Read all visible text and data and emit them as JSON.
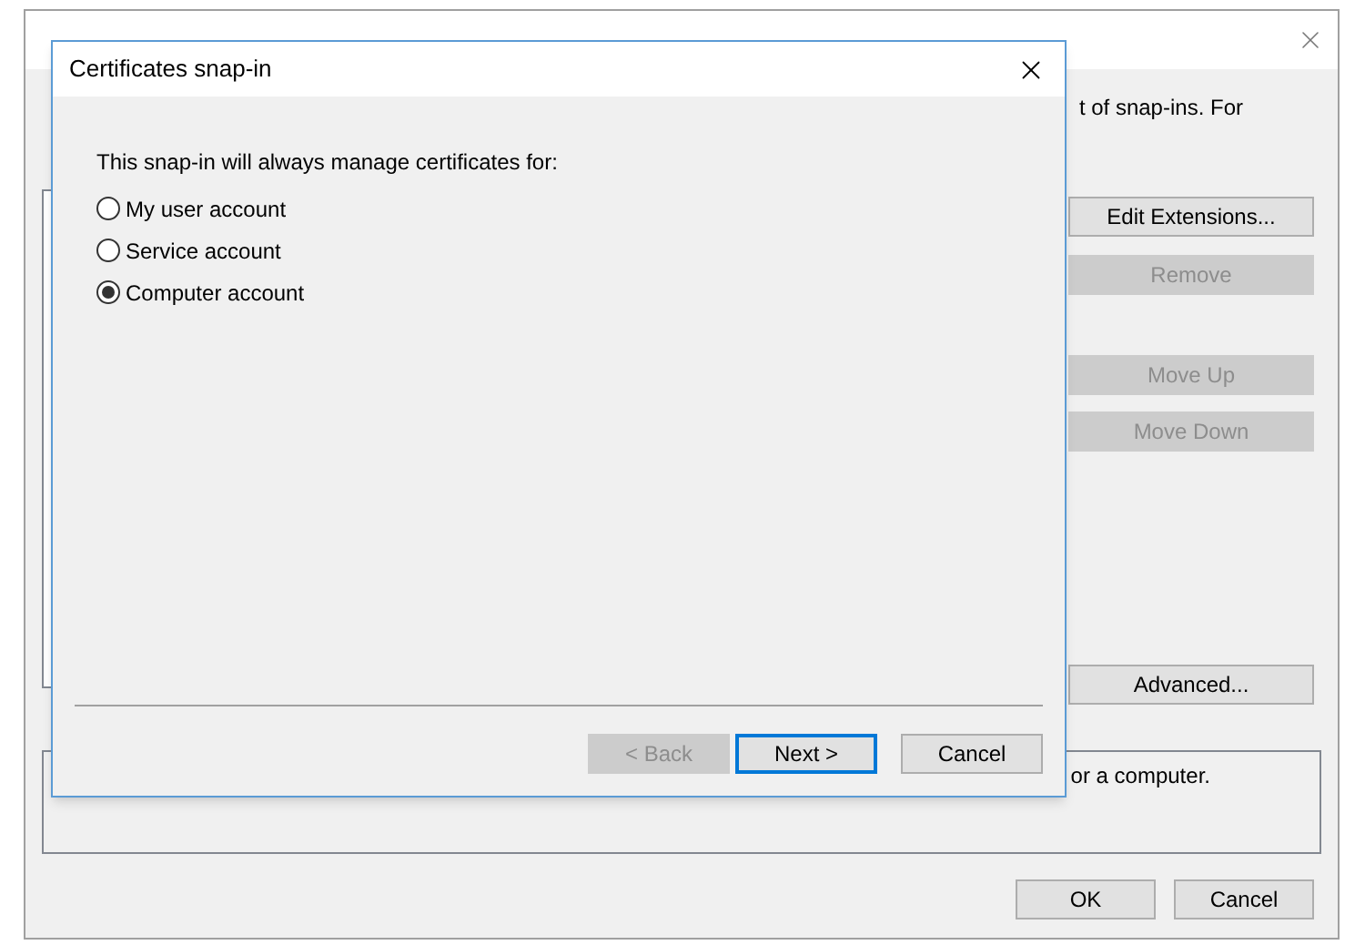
{
  "main_window": {
    "intro_line1_end": "t of snap-ins. For",
    "description_text": "or a computer.",
    "edit_buttons": [
      {
        "label": "Edit Extensions...",
        "disabled": false
      },
      {
        "label": "Remove",
        "disabled": true
      }
    ],
    "order_buttons": [
      {
        "label": "Move Up",
        "disabled": true
      },
      {
        "label": "Move Down",
        "disabled": true
      }
    ],
    "advanced_button": {
      "label": "Advanced...",
      "disabled": false
    },
    "footer_buttons": [
      {
        "label": "OK",
        "disabled": false
      },
      {
        "label": "Cancel",
        "disabled": false
      }
    ]
  },
  "dialog": {
    "title": "Certificates snap-in",
    "prompt": "This snap-in will always manage certificates for:",
    "options": [
      {
        "label": "My user account",
        "selected": false
      },
      {
        "label": "Service account",
        "selected": false
      },
      {
        "label": "Computer account",
        "selected": true
      }
    ],
    "buttons": [
      {
        "label": "< Back",
        "disabled": true,
        "default": false
      },
      {
        "label": "Next >",
        "disabled": false,
        "default": true
      },
      {
        "label": "Cancel",
        "disabled": false,
        "default": false
      }
    ]
  }
}
